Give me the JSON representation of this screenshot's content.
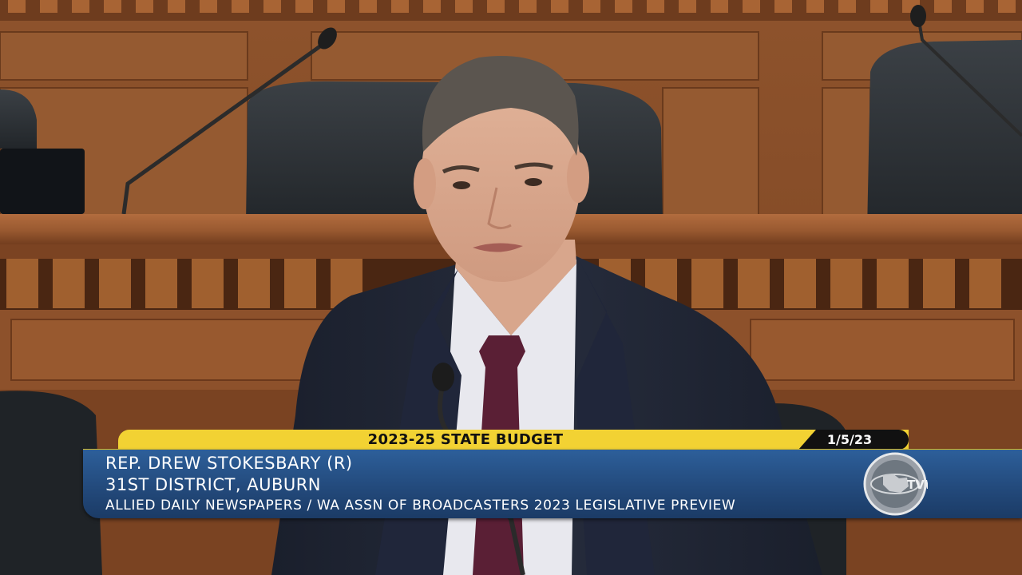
{
  "lower_third": {
    "topic": "2023-25 STATE BUDGET",
    "date": "1/5/23",
    "name": "REP. DREW STOKESBARY (R)",
    "district": "31ST DISTRICT, AUBURN",
    "event": "ALLIED DAILY NEWSPAPERS / WA ASSN OF BROADCASTERS 2023 LEGISLATIVE PREVIEW"
  },
  "logo": {
    "text": "TVW",
    "icon": "tvw-globe-logo"
  },
  "colors": {
    "wood": "#8a4f2a",
    "banner_yellow": "#f2d233",
    "banner_blue": "#234a7c",
    "suit": "#1f2433",
    "tie": "#5a1f35"
  }
}
